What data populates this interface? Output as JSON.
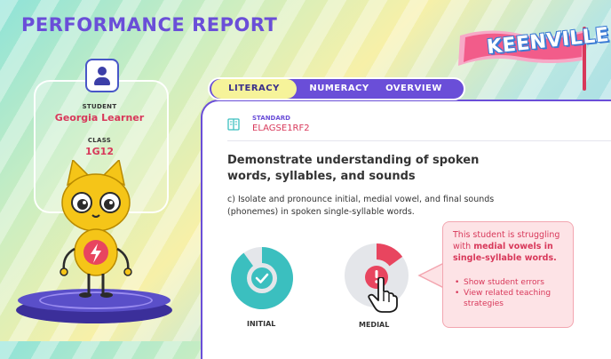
{
  "page": {
    "title": "PERFORMANCE REPORT"
  },
  "brand": {
    "logo_text": "KEENVILLE"
  },
  "student": {
    "student_label": "STUDENT",
    "name": "Georgia Learner",
    "class_label": "CLASS",
    "class_value": "1G12"
  },
  "tabs": [
    {
      "label": "LITERACY",
      "active": true
    },
    {
      "label": "NUMERACY",
      "active": false
    },
    {
      "label": "OVERVIEW",
      "active": false
    }
  ],
  "standard": {
    "label": "STANDARD",
    "code": "ELAGSE1RF2",
    "heading": "Demonstrate understanding of spoken words, syllables, and sounds",
    "description": "c) Isolate and pronounce initial, medial vowel, and final sounds (phonemes) in spoken single-syllable words."
  },
  "skills": [
    {
      "label": "INITIAL",
      "status": "complete",
      "icon": "check-icon",
      "progress": 0.9,
      "color": "#3bbfbf"
    },
    {
      "label": "MEDIAL",
      "status": "struggling",
      "icon": "exclamation-icon",
      "progress": 0.15,
      "color": "#e8455f"
    }
  ],
  "callout": {
    "text_pre": "This student is struggling with ",
    "text_bold": "medial vowels in single-syllable words.",
    "actions": [
      "Show student errors",
      "View related teaching strategies"
    ]
  },
  "colors": {
    "accent": "#6a4ed8",
    "danger": "#d8385a",
    "teal": "#3bbfbf",
    "tab_active": "#f6f39a"
  }
}
